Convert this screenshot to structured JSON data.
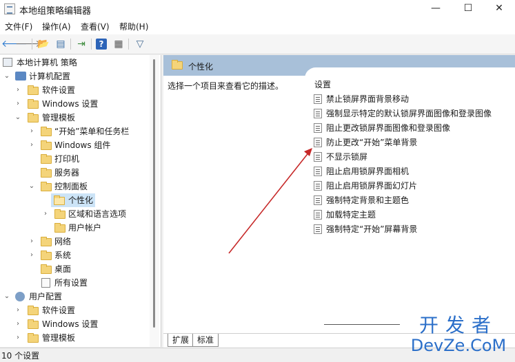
{
  "window": {
    "title": "本地组策略编辑器",
    "minimize": "—",
    "maximize": "☐",
    "close": "✕"
  },
  "menu": [
    "文件(F)",
    "操作(A)",
    "查看(V)",
    "帮助(H)"
  ],
  "toolbar": {
    "back": "🡐",
    "forward": "🡒",
    "up_folder": "📂",
    "show_hide": "▤",
    "export": "⇥",
    "help": "?",
    "properties": "▦",
    "filter": "▽"
  },
  "tree": {
    "root": "本地计算机 策略",
    "computer_config": "计算机配置",
    "software_settings": "软件设置",
    "windows_settings": "Windows 设置",
    "admin_templates": "管理模板",
    "start_menu": "“开始”菜单和任务栏",
    "windows_components": "Windows 组件",
    "printers": "打印机",
    "server": "服务器",
    "control_panel": "控制面板",
    "personalization": "个性化",
    "region_language": "区域和语言选项",
    "user_accounts": "用户帐户",
    "network": "网络",
    "system": "系统",
    "desktop": "桌面",
    "all_settings": "所有设置",
    "user_config": "用户配置",
    "u_software_settings": "软件设置",
    "u_windows_settings": "Windows 设置",
    "u_admin_templates": "管理模板"
  },
  "content": {
    "header": "个性化",
    "description": "选择一个项目来查看它的描述。",
    "settings_header": "设置",
    "settings": [
      "禁止锁屏界面背景移动",
      "强制显示特定的默认锁屏界面图像和登录图像",
      "阻止更改锁屏界面图像和登录图像",
      "防止更改“开始”菜单背景",
      "不显示锁屏",
      "阻止启用锁屏界面相机",
      "阻止启用锁屏界面幻灯片",
      "强制特定背景和主题色",
      "加载特定主题",
      "强制特定“开始”屏幕背景"
    ]
  },
  "tabs": {
    "extended": "扩展",
    "standard": "标准"
  },
  "status": "10 个设置",
  "watermark": {
    "line1": "开发者",
    "line2": "DevZe.CoM"
  },
  "colors": {
    "accent_arrow": "#c62828",
    "header_bg": "#a8c0d9",
    "watermark": "#2b6fc9"
  }
}
